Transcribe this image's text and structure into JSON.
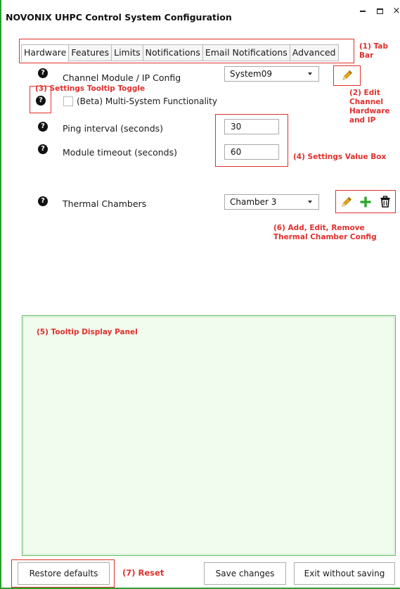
{
  "window": {
    "title": "NOVONIX UHPC Control System Configuration",
    "minimize_glyph": "minimize-icon",
    "maximize_glyph": "maximize-icon",
    "close_label": "×"
  },
  "tabs": [
    {
      "label": "Hardware",
      "active": true
    },
    {
      "label": "Features",
      "active": false
    },
    {
      "label": "Limits",
      "active": false
    },
    {
      "label": "Notifications",
      "active": false
    },
    {
      "label": "Email Notifications",
      "active": false
    },
    {
      "label": "Advanced",
      "active": false
    }
  ],
  "settings": {
    "help_glyph": "?",
    "channel_module": {
      "label": "Channel Module / IP Config",
      "selected": "System09"
    },
    "multi_system": {
      "label": "(Beta) Multi-System Functionality",
      "checked": false
    },
    "ping_interval": {
      "label": "Ping interval (seconds)",
      "value": "30"
    },
    "module_timeout": {
      "label": "Module timeout (seconds)",
      "value": "60"
    },
    "thermal_chambers": {
      "label": "Thermal Chambers",
      "selected": "Chamber 3"
    }
  },
  "annotations": {
    "tab_bar": "(1) Tab Bar",
    "edit_channel": [
      "(2) Edit",
      "Channel",
      "Hardware",
      "and IP"
    ],
    "tooltip_toggle": "(3) Settings Tooltip Toggle",
    "value_box": "(4) Settings Value Box",
    "tooltip_panel": "(5) Tooltip Display Panel",
    "thermal_config": [
      "(6) Add, Edit, Remove",
      "Thermal Chamber Config"
    ],
    "reset": "(7) Reset"
  },
  "buttons": {
    "restore_defaults": "Restore defaults",
    "save_changes": "Save changes",
    "exit_without_saving": "Exit without saving"
  },
  "colors": {
    "annotation_red": "#e0302d",
    "frame_green": "#2aa12a",
    "tooltip_panel_bg": "#f1fbee",
    "pencil_orange": "#e8a317",
    "plus_green": "#2ea52e"
  },
  "icons": [
    "pencil-icon",
    "plus-icon",
    "trash-icon",
    "help-icon"
  ]
}
